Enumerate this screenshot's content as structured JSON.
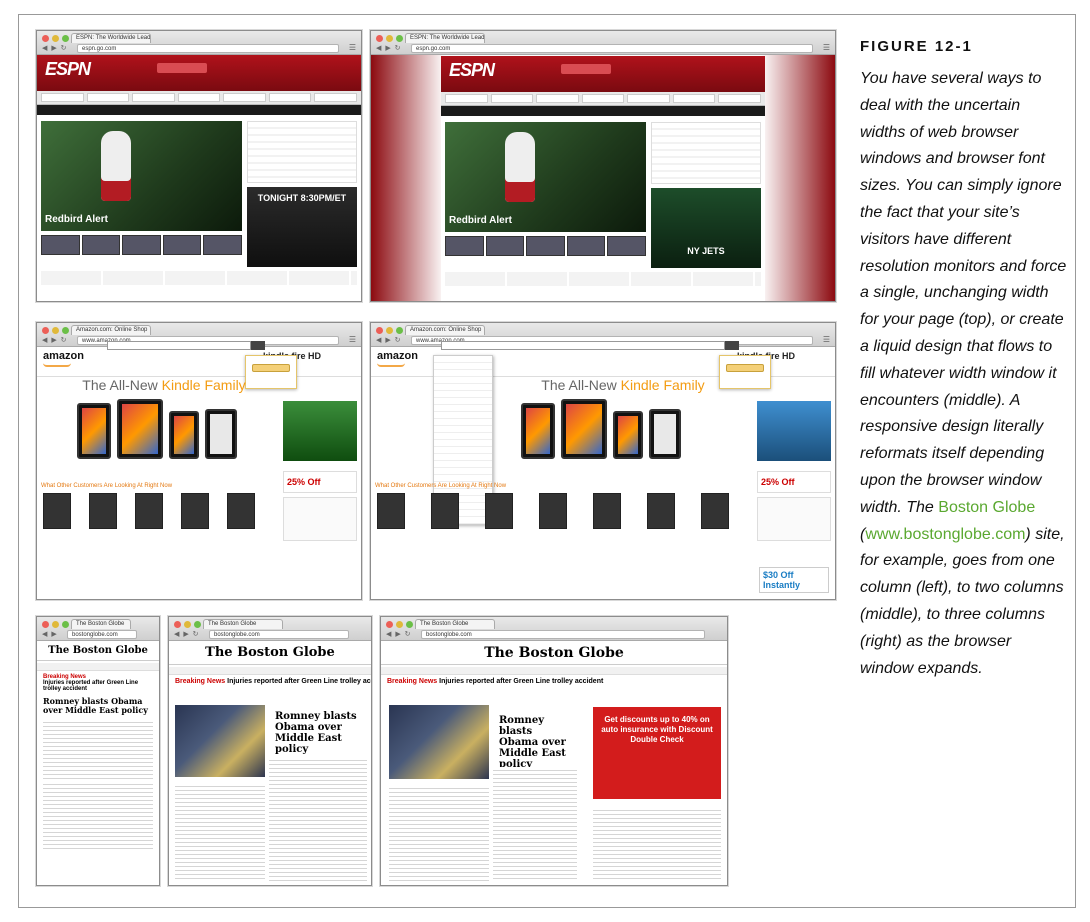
{
  "figure": {
    "title": "FIGURE 12-1",
    "caption_before_link": "You have several ways to deal with the uncertain widths of web browser windows and browser font sizes. You can simply ignore the fact that your site’s visitors have different resolution monitors and force a single, unchanging width for your page (top), or create a liquid design that flows to fill whatever width window it encounters (middle). A responsive design literally reformats itself depending upon the browser window width. The ",
    "link1": "Boston Globe",
    "caption_middle": " (",
    "link2": "www.bostonglobe.com",
    "caption_after": ") site, for example, goes from one column (left), to two columns (middle), to three columns (right) as the browser window expands."
  },
  "espn": {
    "tab": "ESPN: The Worldwide Lead",
    "url": "espn.go.com",
    "logo": "ESPN",
    "hero_caption": "Redbird Alert",
    "ad_text": "TONIGHT 8:30PM/ET",
    "ad_team": "NY JETS"
  },
  "amazon": {
    "tab": "Amazon.com: Online Shop",
    "url": "www.amazon.com",
    "logo": "amazon",
    "kindle": "kindle fire HD",
    "banner_plain": "The All-New ",
    "banner_accent": "Kindle Family",
    "ad_sale": "25% Off",
    "strip": "What Other Customers Are Looking At Right Now",
    "ad_offer": "$30 Off Instantly"
  },
  "globe": {
    "tab": "The Boston Globe",
    "url": "bostonglobe.com",
    "logo": "The Boston Globe",
    "breaking_label": "Breaking News",
    "breaking_text": "Injuries reported after Green Line trolley accident",
    "headline": "Romney blasts Obama over Middle East policy",
    "ad": "Get discounts up to 40% on auto insurance with Discount Double Check"
  }
}
